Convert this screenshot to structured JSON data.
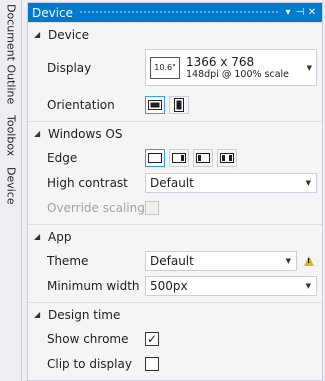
{
  "side_tabs": [
    "Document Outline",
    "Toolbox",
    "Device"
  ],
  "panel": {
    "title": "Device",
    "title_buttons": [
      "▾",
      "⊣",
      "✕"
    ]
  },
  "sections": {
    "device": {
      "header": "Device",
      "display_label": "Display",
      "display_size": "10.6\"",
      "display_resolution": "1366 x 768",
      "display_detail": "148dpi @ 100% scale",
      "orientation_label": "Orientation"
    },
    "windows_os": {
      "header": "Windows OS",
      "edge_label": "Edge",
      "high_contrast_label": "High contrast",
      "high_contrast_value": "Default",
      "override_scaling_label": "Override scaling"
    },
    "app": {
      "header": "App",
      "theme_label": "Theme",
      "theme_value": "Default",
      "min_width_label": "Minimum width",
      "min_width_value": "500px"
    },
    "design_time": {
      "header": "Design time",
      "show_chrome_label": "Show chrome",
      "show_chrome_checked": true,
      "show_chrome_mark": "✓",
      "clip_label": "Clip to display",
      "clip_checked": false
    }
  },
  "colors": {
    "accent": "#007acc",
    "selected_border": "#3399ff",
    "warning": "#e8b400"
  },
  "icons": {
    "expand": "triangle-down-icon",
    "dropdown": "chevron-down-icon",
    "warning": "warning-icon"
  }
}
